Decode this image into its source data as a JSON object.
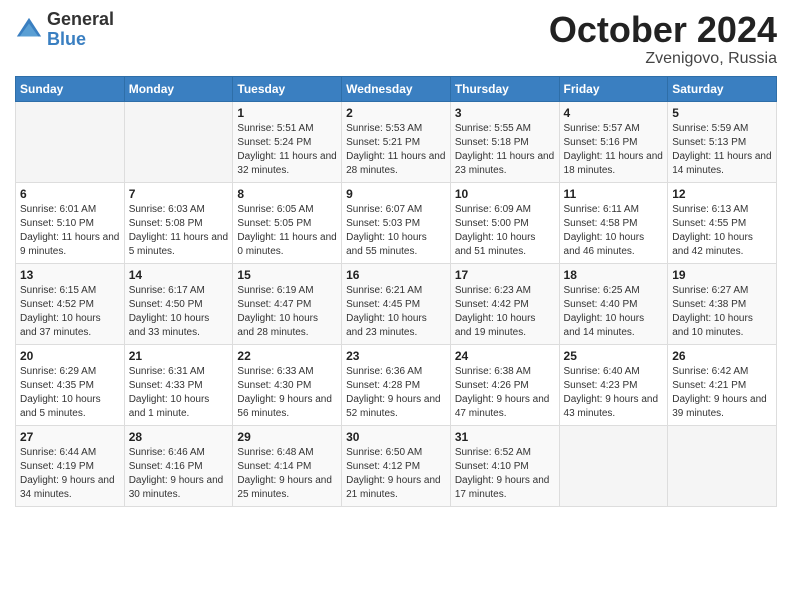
{
  "logo": {
    "general": "General",
    "blue": "Blue"
  },
  "header": {
    "month": "October 2024",
    "location": "Zvenigovo, Russia"
  },
  "weekdays": [
    "Sunday",
    "Monday",
    "Tuesday",
    "Wednesday",
    "Thursday",
    "Friday",
    "Saturday"
  ],
  "weeks": [
    [
      {
        "day": "",
        "sunrise": "",
        "sunset": "",
        "daylight": ""
      },
      {
        "day": "",
        "sunrise": "",
        "sunset": "",
        "daylight": ""
      },
      {
        "day": "1",
        "sunrise": "Sunrise: 5:51 AM",
        "sunset": "Sunset: 5:24 PM",
        "daylight": "Daylight: 11 hours and 32 minutes."
      },
      {
        "day": "2",
        "sunrise": "Sunrise: 5:53 AM",
        "sunset": "Sunset: 5:21 PM",
        "daylight": "Daylight: 11 hours and 28 minutes."
      },
      {
        "day": "3",
        "sunrise": "Sunrise: 5:55 AM",
        "sunset": "Sunset: 5:18 PM",
        "daylight": "Daylight: 11 hours and 23 minutes."
      },
      {
        "day": "4",
        "sunrise": "Sunrise: 5:57 AM",
        "sunset": "Sunset: 5:16 PM",
        "daylight": "Daylight: 11 hours and 18 minutes."
      },
      {
        "day": "5",
        "sunrise": "Sunrise: 5:59 AM",
        "sunset": "Sunset: 5:13 PM",
        "daylight": "Daylight: 11 hours and 14 minutes."
      }
    ],
    [
      {
        "day": "6",
        "sunrise": "Sunrise: 6:01 AM",
        "sunset": "Sunset: 5:10 PM",
        "daylight": "Daylight: 11 hours and 9 minutes."
      },
      {
        "day": "7",
        "sunrise": "Sunrise: 6:03 AM",
        "sunset": "Sunset: 5:08 PM",
        "daylight": "Daylight: 11 hours and 5 minutes."
      },
      {
        "day": "8",
        "sunrise": "Sunrise: 6:05 AM",
        "sunset": "Sunset: 5:05 PM",
        "daylight": "Daylight: 11 hours and 0 minutes."
      },
      {
        "day": "9",
        "sunrise": "Sunrise: 6:07 AM",
        "sunset": "Sunset: 5:03 PM",
        "daylight": "Daylight: 10 hours and 55 minutes."
      },
      {
        "day": "10",
        "sunrise": "Sunrise: 6:09 AM",
        "sunset": "Sunset: 5:00 PM",
        "daylight": "Daylight: 10 hours and 51 minutes."
      },
      {
        "day": "11",
        "sunrise": "Sunrise: 6:11 AM",
        "sunset": "Sunset: 4:58 PM",
        "daylight": "Daylight: 10 hours and 46 minutes."
      },
      {
        "day": "12",
        "sunrise": "Sunrise: 6:13 AM",
        "sunset": "Sunset: 4:55 PM",
        "daylight": "Daylight: 10 hours and 42 minutes."
      }
    ],
    [
      {
        "day": "13",
        "sunrise": "Sunrise: 6:15 AM",
        "sunset": "Sunset: 4:52 PM",
        "daylight": "Daylight: 10 hours and 37 minutes."
      },
      {
        "day": "14",
        "sunrise": "Sunrise: 6:17 AM",
        "sunset": "Sunset: 4:50 PM",
        "daylight": "Daylight: 10 hours and 33 minutes."
      },
      {
        "day": "15",
        "sunrise": "Sunrise: 6:19 AM",
        "sunset": "Sunset: 4:47 PM",
        "daylight": "Daylight: 10 hours and 28 minutes."
      },
      {
        "day": "16",
        "sunrise": "Sunrise: 6:21 AM",
        "sunset": "Sunset: 4:45 PM",
        "daylight": "Daylight: 10 hours and 23 minutes."
      },
      {
        "day": "17",
        "sunrise": "Sunrise: 6:23 AM",
        "sunset": "Sunset: 4:42 PM",
        "daylight": "Daylight: 10 hours and 19 minutes."
      },
      {
        "day": "18",
        "sunrise": "Sunrise: 6:25 AM",
        "sunset": "Sunset: 4:40 PM",
        "daylight": "Daylight: 10 hours and 14 minutes."
      },
      {
        "day": "19",
        "sunrise": "Sunrise: 6:27 AM",
        "sunset": "Sunset: 4:38 PM",
        "daylight": "Daylight: 10 hours and 10 minutes."
      }
    ],
    [
      {
        "day": "20",
        "sunrise": "Sunrise: 6:29 AM",
        "sunset": "Sunset: 4:35 PM",
        "daylight": "Daylight: 10 hours and 5 minutes."
      },
      {
        "day": "21",
        "sunrise": "Sunrise: 6:31 AM",
        "sunset": "Sunset: 4:33 PM",
        "daylight": "Daylight: 10 hours and 1 minute."
      },
      {
        "day": "22",
        "sunrise": "Sunrise: 6:33 AM",
        "sunset": "Sunset: 4:30 PM",
        "daylight": "Daylight: 9 hours and 56 minutes."
      },
      {
        "day": "23",
        "sunrise": "Sunrise: 6:36 AM",
        "sunset": "Sunset: 4:28 PM",
        "daylight": "Daylight: 9 hours and 52 minutes."
      },
      {
        "day": "24",
        "sunrise": "Sunrise: 6:38 AM",
        "sunset": "Sunset: 4:26 PM",
        "daylight": "Daylight: 9 hours and 47 minutes."
      },
      {
        "day": "25",
        "sunrise": "Sunrise: 6:40 AM",
        "sunset": "Sunset: 4:23 PM",
        "daylight": "Daylight: 9 hours and 43 minutes."
      },
      {
        "day": "26",
        "sunrise": "Sunrise: 6:42 AM",
        "sunset": "Sunset: 4:21 PM",
        "daylight": "Daylight: 9 hours and 39 minutes."
      }
    ],
    [
      {
        "day": "27",
        "sunrise": "Sunrise: 6:44 AM",
        "sunset": "Sunset: 4:19 PM",
        "daylight": "Daylight: 9 hours and 34 minutes."
      },
      {
        "day": "28",
        "sunrise": "Sunrise: 6:46 AM",
        "sunset": "Sunset: 4:16 PM",
        "daylight": "Daylight: 9 hours and 30 minutes."
      },
      {
        "day": "29",
        "sunrise": "Sunrise: 6:48 AM",
        "sunset": "Sunset: 4:14 PM",
        "daylight": "Daylight: 9 hours and 25 minutes."
      },
      {
        "day": "30",
        "sunrise": "Sunrise: 6:50 AM",
        "sunset": "Sunset: 4:12 PM",
        "daylight": "Daylight: 9 hours and 21 minutes."
      },
      {
        "day": "31",
        "sunrise": "Sunrise: 6:52 AM",
        "sunset": "Sunset: 4:10 PM",
        "daylight": "Daylight: 9 hours and 17 minutes."
      },
      {
        "day": "",
        "sunrise": "",
        "sunset": "",
        "daylight": ""
      },
      {
        "day": "",
        "sunrise": "",
        "sunset": "",
        "daylight": ""
      }
    ]
  ]
}
